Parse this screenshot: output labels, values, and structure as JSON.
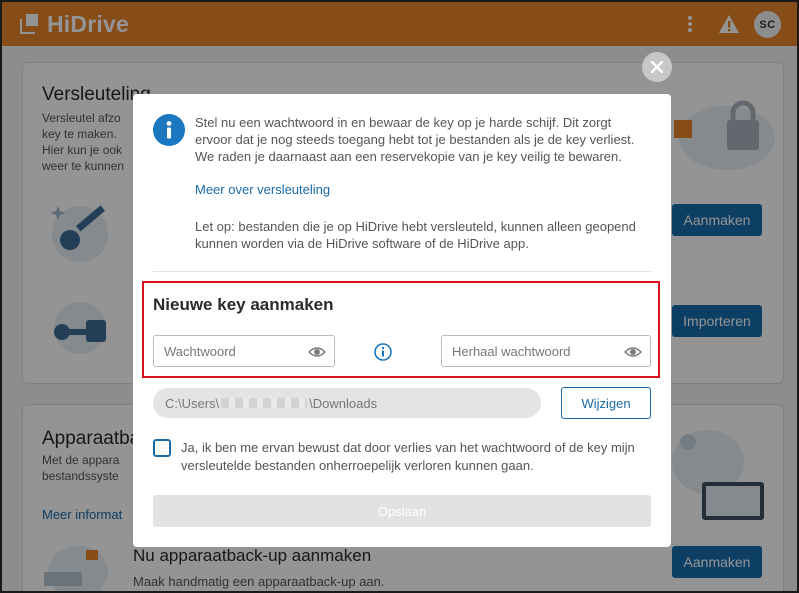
{
  "app": {
    "logo_text": "HiDrive",
    "avatar_initials": "SC"
  },
  "background": {
    "encryption_section": {
      "title": "Versleuteling",
      "text_lines": [
        "Versleutel afzo",
        "key te maken.",
        "Hier kun je ook",
        "weer te kunnen"
      ],
      "create_button": "Aanmaken",
      "import_button": "Importeren"
    },
    "backup_section": {
      "title": "Apparaatba",
      "text_lines": [
        "Met de appara",
        "bestandssyste"
      ],
      "link": "Meer informat",
      "subsection_title": "Nu apparaatback-up aanmaken",
      "subsection_text": "Maak handmatig een apparaatback-up aan.",
      "create_button": "Aanmaken"
    }
  },
  "modal": {
    "info_text": "Stel nu een wachtwoord in en bewaar de key op je harde schijf. Dit zorgt ervoor dat je nog steeds toegang hebt tot je bestanden als je de key verliest. We raden je daarnaast aan een reservekopie van je key veilig te bewaren.",
    "info_link": "Meer over versleuteling",
    "note_text": "Let op: bestanden die je op HiDrive hebt versleuteld, kunnen alleen geopend kunnen worden via de HiDrive software of de HiDrive app.",
    "section_title": "Nieuwe key aanmaken",
    "password_placeholder": "Wachtwoord",
    "repeat_password_placeholder": "Herhaal wachtwoord",
    "path": {
      "prefix": "C:\\Users\\",
      "suffix": "\\Downloads"
    },
    "change_button": "Wijzigen",
    "checkbox_label": "Ja, ik ben me ervan bewust dat door verlies van het wachtwoord of de key mijn versleutelde bestanden onherroepelijk verloren kunnen gaan.",
    "save_button": "Opslaan"
  },
  "colors": {
    "topbar": "#e8862c",
    "primary": "#176cad",
    "highlight_border": "#d8131c"
  },
  "icons": [
    "logo-icon",
    "more-vertical-icon",
    "warning-icon",
    "close-icon",
    "info-icon",
    "eye-icon"
  ]
}
